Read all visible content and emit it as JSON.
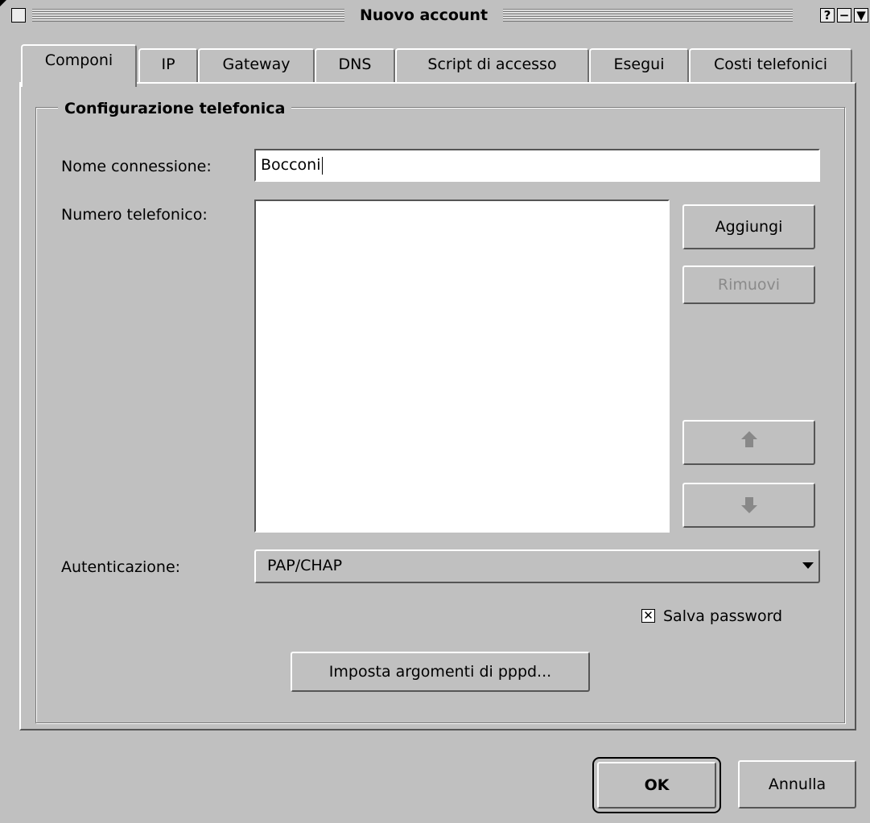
{
  "window": {
    "title": "Nuovo account",
    "help_glyph": "?",
    "minimize_glyph": "−",
    "menu_glyph": "▼"
  },
  "tabs": [
    {
      "label": "Componi"
    },
    {
      "label": "IP"
    },
    {
      "label": "Gateway"
    },
    {
      "label": "DNS"
    },
    {
      "label": "Script di accesso"
    },
    {
      "label": "Esegui"
    },
    {
      "label": "Costi telefonici"
    }
  ],
  "group": {
    "title": "Configurazione telefonica"
  },
  "connection_name": {
    "label": "Nome connessione:",
    "value": "Bocconi"
  },
  "phone_number": {
    "label": "Numero telefonico:"
  },
  "buttons": {
    "add": "Aggiungi",
    "remove": "Rimuovi",
    "pppd": "Imposta argomenti di pppd...",
    "ok": "OK",
    "cancel": "Annulla"
  },
  "authentication": {
    "label": "Autenticazione:",
    "selected": "PAP/CHAP"
  },
  "save_password": {
    "label": "Salva password",
    "checked": true,
    "glyph": "✕"
  }
}
